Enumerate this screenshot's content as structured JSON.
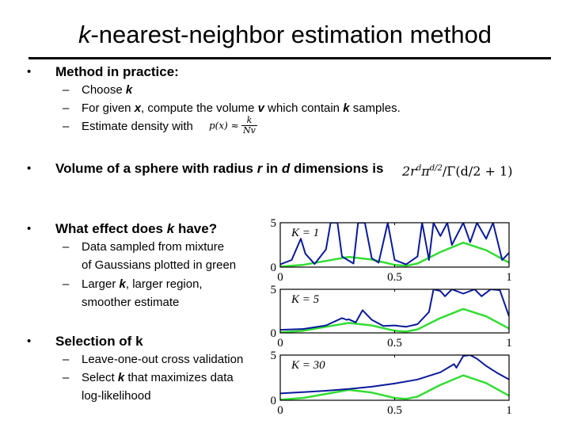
{
  "title": {
    "k": "k",
    "rest": "-nearest-neighbor estimation method"
  },
  "bullets": [
    {
      "label": "Method in practice:",
      "subs": [
        {
          "pre": "Choose ",
          "k": "k"
        },
        {
          "pre": "For given ",
          "x": "x",
          "mid": ", compute the volume ",
          "v": "v",
          "mid2": " which contain ",
          "k": "k",
          "post": " samples."
        },
        {
          "pre": "Estimate density with",
          "formula": {
            "lhs": "p(x) ≈",
            "num": "k",
            "den": "Nv"
          }
        }
      ]
    },
    {
      "pre": "Volume of a sphere with radius ",
      "r": "r",
      "mid": " in ",
      "d": "d",
      "post": " dimensions is",
      "formula": "2r^d π^(d/2) / Γ(d/2 + 1)",
      "formula_parts": {
        "a": "2r",
        "sup1": "d",
        "b": "π",
        "sup2": "d/2",
        "c": "/Γ(d/2 + 1)"
      }
    },
    {
      "pre": "What effect does ",
      "k": "k",
      "post": " have?",
      "subs": [
        {
          "line1": "Data sampled from mixture",
          "line2": "of Gaussians plotted in green"
        },
        {
          "pre": "Larger ",
          "k": "k",
          "post": ", larger region,",
          "line2": "smoother estimate"
        }
      ]
    },
    {
      "label": "Selection of k",
      "subs": [
        {
          "text": "Leave-one-out cross validation"
        },
        {
          "pre": "Select ",
          "k": "k",
          "post": " that maximizes data",
          "line2": "log-likelihood"
        }
      ]
    }
  ],
  "colors": {
    "estimate": "#0a1a9a",
    "true_density": "#33dd33",
    "axis": "#000000"
  },
  "chart_data": [
    {
      "type": "line",
      "title": "",
      "annotation": "K = 1",
      "xlim": [
        0,
        1
      ],
      "ylim": [
        0,
        5
      ],
      "xticks": [
        "0",
        "0.5",
        "1"
      ],
      "yticks": [
        "0",
        "5"
      ],
      "series": [
        {
          "name": "true density (mixture of Gaussians)",
          "color": "green",
          "x": [
            0,
            0.1,
            0.2,
            0.3,
            0.4,
            0.5,
            0.55,
            0.6,
            0.7,
            0.8,
            0.9,
            1.0
          ],
          "y": [
            0.05,
            0.25,
            0.7,
            1.15,
            0.85,
            0.25,
            0.15,
            0.4,
            1.7,
            2.75,
            1.9,
            0.5
          ]
        },
        {
          "name": "kNN estimate K=1",
          "color": "blue",
          "x": [
            0,
            0.05,
            0.09,
            0.11,
            0.15,
            0.2,
            0.22,
            0.25,
            0.27,
            0.32,
            0.34,
            0.37,
            0.4,
            0.43,
            0.47,
            0.5,
            0.55,
            0.6,
            0.62,
            0.65,
            0.67,
            0.7,
            0.73,
            0.75,
            0.8,
            0.83,
            0.86,
            0.9,
            0.93,
            0.97,
            1.0
          ],
          "y": [
            0.3,
            0.8,
            3.2,
            1.5,
            0.35,
            2.0,
            5,
            5,
            1.2,
            0.4,
            5,
            5,
            1.0,
            0.5,
            5,
            0.8,
            0.3,
            1.2,
            5,
            0.8,
            5,
            3.5,
            5,
            2.5,
            5,
            2.8,
            5,
            3.2,
            5,
            0.8,
            1.6
          ]
        }
      ]
    },
    {
      "type": "line",
      "title": "",
      "annotation": "K = 5",
      "xlim": [
        0,
        1
      ],
      "ylim": [
        0,
        5
      ],
      "xticks": [
        "0",
        "0.5",
        "1"
      ],
      "yticks": [
        "0",
        "5"
      ],
      "series": [
        {
          "name": "true density (mixture of Gaussians)",
          "color": "green",
          "x": [
            0,
            0.1,
            0.2,
            0.3,
            0.4,
            0.5,
            0.55,
            0.6,
            0.7,
            0.8,
            0.9,
            1.0
          ],
          "y": [
            0.05,
            0.25,
            0.7,
            1.15,
            0.85,
            0.25,
            0.15,
            0.4,
            1.7,
            2.75,
            1.9,
            0.5
          ]
        },
        {
          "name": "kNN estimate K=5",
          "color": "blue",
          "x": [
            0,
            0.1,
            0.2,
            0.27,
            0.29,
            0.3,
            0.33,
            0.36,
            0.4,
            0.45,
            0.5,
            0.55,
            0.6,
            0.65,
            0.67,
            0.7,
            0.72,
            0.75,
            0.8,
            0.85,
            0.88,
            0.92,
            0.96,
            1.0
          ],
          "y": [
            0.35,
            0.45,
            0.85,
            1.7,
            1.5,
            1.55,
            1.2,
            2.6,
            1.5,
            0.8,
            0.85,
            0.7,
            1.0,
            2.4,
            5,
            4.8,
            4.2,
            5,
            4.5,
            5,
            4.2,
            5,
            4.9,
            1.9
          ]
        }
      ]
    },
    {
      "type": "line",
      "title": "",
      "annotation": "K = 30",
      "xlim": [
        0,
        1
      ],
      "ylim": [
        0,
        5
      ],
      "xticks": [
        "0",
        "0.5",
        "1"
      ],
      "yticks": [
        "0",
        "5"
      ],
      "series": [
        {
          "name": "true density (mixture of Gaussians)",
          "color": "green",
          "x": [
            0,
            0.1,
            0.2,
            0.3,
            0.4,
            0.5,
            0.55,
            0.6,
            0.7,
            0.8,
            0.9,
            1.0
          ],
          "y": [
            0.05,
            0.25,
            0.7,
            1.15,
            0.85,
            0.25,
            0.15,
            0.4,
            1.7,
            2.75,
            1.9,
            0.5
          ]
        },
        {
          "name": "kNN estimate K=30",
          "color": "blue",
          "x": [
            0,
            0.1,
            0.2,
            0.3,
            0.4,
            0.5,
            0.6,
            0.7,
            0.76,
            0.77,
            0.8,
            0.83,
            0.86,
            0.9,
            0.95,
            1.0
          ],
          "y": [
            0.75,
            0.9,
            1.05,
            1.25,
            1.5,
            1.85,
            2.3,
            3.1,
            4.0,
            3.6,
            4.9,
            5.0,
            4.6,
            3.8,
            3.0,
            2.3
          ]
        }
      ]
    }
  ]
}
